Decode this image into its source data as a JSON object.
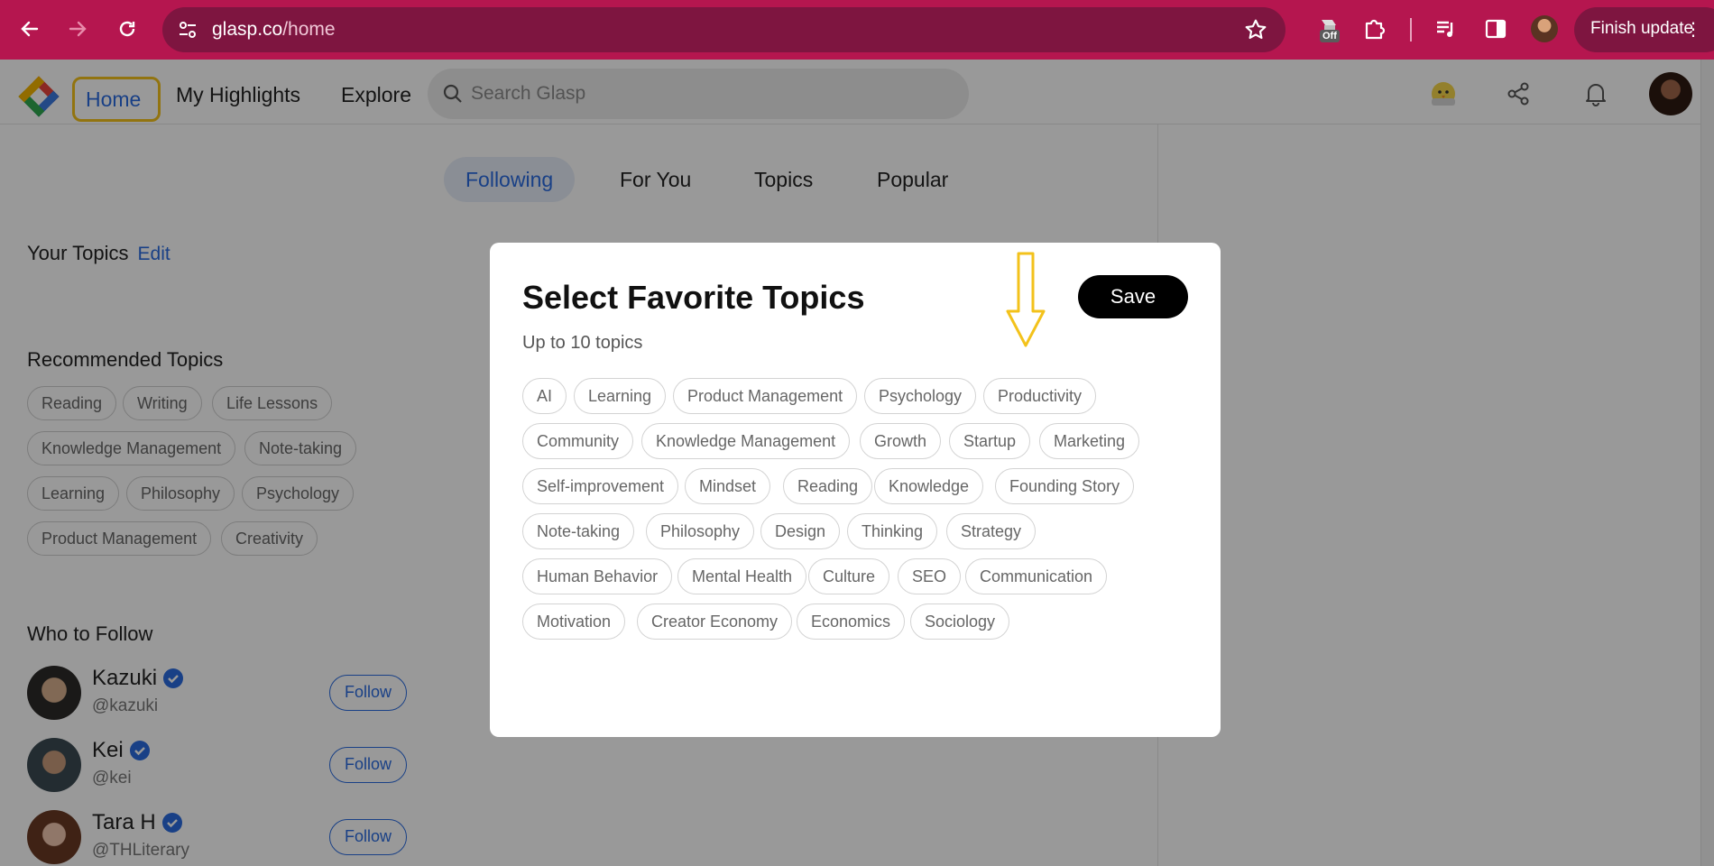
{
  "browser": {
    "url_host": "glasp.co",
    "url_path": "/home",
    "off_badge": "Off",
    "finish_update_label": "Finish update"
  },
  "app": {
    "nav": {
      "home": "Home",
      "my_highlights": "My Highlights",
      "explore": "Explore"
    },
    "search_placeholder": "Search Glasp"
  },
  "sidebar": {
    "your_topics_title": "Your Topics",
    "edit_label": "Edit",
    "recommended_title": "Recommended Topics",
    "recommended": [
      "Reading",
      "Writing",
      "Life Lessons",
      "Knowledge Management",
      "Note-taking",
      "Learning",
      "Philosophy",
      "Psychology",
      "Product Management",
      "Creativity"
    ],
    "who_to_follow_title": "Who to Follow",
    "follow_label": "Follow",
    "people": [
      {
        "name": "Kazuki",
        "handle": "@kazuki"
      },
      {
        "name": "Kei",
        "handle": "@kei"
      },
      {
        "name": "Tara H",
        "handle": "@THLiterary"
      }
    ]
  },
  "feed": {
    "tabs": [
      "Following",
      "For You",
      "Topics",
      "Popular"
    ],
    "active_tab": "Following"
  },
  "modal": {
    "title": "Select Favorite Topics",
    "subtitle": "Up to 10 topics",
    "save_label": "Save",
    "topics": [
      "AI",
      "Learning",
      "Product Management",
      "Psychology",
      "Productivity",
      "Community",
      "Knowledge Management",
      "Growth",
      "Startup",
      "Marketing",
      "Self-improvement",
      "Mindset",
      "Reading",
      "Knowledge",
      "Founding Story",
      "Note-taking",
      "Philosophy",
      "Design",
      "Thinking",
      "Strategy",
      "Human Behavior",
      "Mental Health",
      "Culture",
      "SEO",
      "Communication",
      "Motivation",
      "Creator Economy",
      "Economics",
      "Sociology"
    ]
  },
  "colors": {
    "browser_frame": "#b5164f",
    "accent_blue": "#2a6be0",
    "highlight_yellow": "#f3c21b",
    "save_button": "#000000"
  }
}
